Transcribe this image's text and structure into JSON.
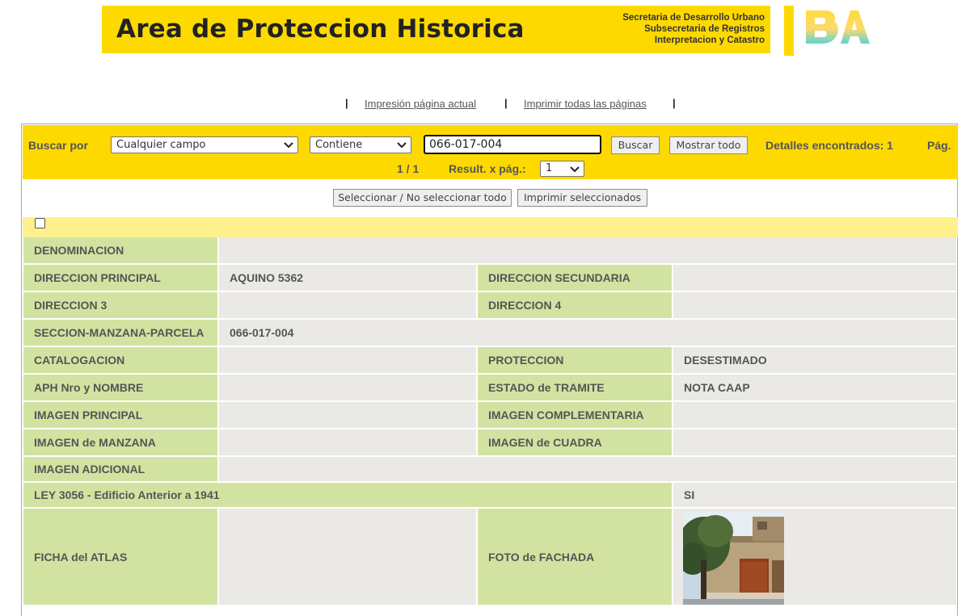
{
  "header": {
    "title": "Area de Proteccion Historica",
    "subtitle_lines": [
      "Secretaria de Desarrollo Urbano",
      "Subsecretaria de Registros",
      "Interpretacion y Catastro"
    ],
    "logo_text": "BA",
    "brand_color": "#fed900"
  },
  "print_links": {
    "current_page": "Impresión página actual",
    "all_pages": "Imprimir todas las páginas",
    "separator": "|"
  },
  "search": {
    "search_by_label": "Buscar por",
    "field_select_value": "Cualquier campo",
    "operator_select_value": "Contiene",
    "query_value": "066-017-004",
    "search_button": "Buscar",
    "show_all_button": "Mostrar todo",
    "found_label": "Detalles encontrados: 1",
    "page_label": "Pág.",
    "pagination": "1 / 1",
    "results_per_page_label": "Result. x pág.:",
    "results_per_page_value": "1"
  },
  "actions": {
    "select_toggle_button": "Seleccionar / No seleccionar todo",
    "print_selected_button": "Imprimir seleccionados"
  },
  "record": {
    "denominacion": {
      "label": "DENOMINACION",
      "value": ""
    },
    "direccion_principal": {
      "label": "DIRECCION PRINCIPAL",
      "value": "AQUINO 5362"
    },
    "direccion_secundaria": {
      "label": "DIRECCION SECUNDARIA",
      "value": ""
    },
    "direccion_3": {
      "label": "DIRECCION 3",
      "value": ""
    },
    "direccion_4": {
      "label": "DIRECCION 4",
      "value": ""
    },
    "smp": {
      "label": "SECCION-MANZANA-PARCELA",
      "value": "066-017-004"
    },
    "catalogacion": {
      "label": "CATALOGACION",
      "value": ""
    },
    "proteccion": {
      "label": "PROTECCION",
      "value": "DESESTIMADO"
    },
    "aph_nombre": {
      "label": "APH Nro y NOMBRE",
      "value": ""
    },
    "estado_tramite": {
      "label": "ESTADO de TRAMITE",
      "value": "NOTA CAAP"
    },
    "imagen_principal": {
      "label": "IMAGEN PRINCIPAL",
      "value": ""
    },
    "imagen_complementaria": {
      "label": "IMAGEN COMPLEMENTARIA",
      "value": ""
    },
    "imagen_manzana": {
      "label": "IMAGEN de MANZANA",
      "value": ""
    },
    "imagen_cuadra": {
      "label": "IMAGEN de CUADRA",
      "value": ""
    },
    "imagen_adicional": {
      "label": "IMAGEN ADICIONAL",
      "value": ""
    },
    "ley_3056": {
      "label": "LEY 3056 - Edificio Anterior a 1941",
      "value": "SI"
    },
    "ficha_atlas": {
      "label": "FICHA del ATLAS",
      "value": ""
    },
    "foto_fachada": {
      "label": "FOTO de FACHADA",
      "value": ""
    }
  },
  "colors": {
    "label_cell": "#d2e3a1",
    "value_cell": "#ebe9e6",
    "checkbox_row": "#fef08c"
  }
}
